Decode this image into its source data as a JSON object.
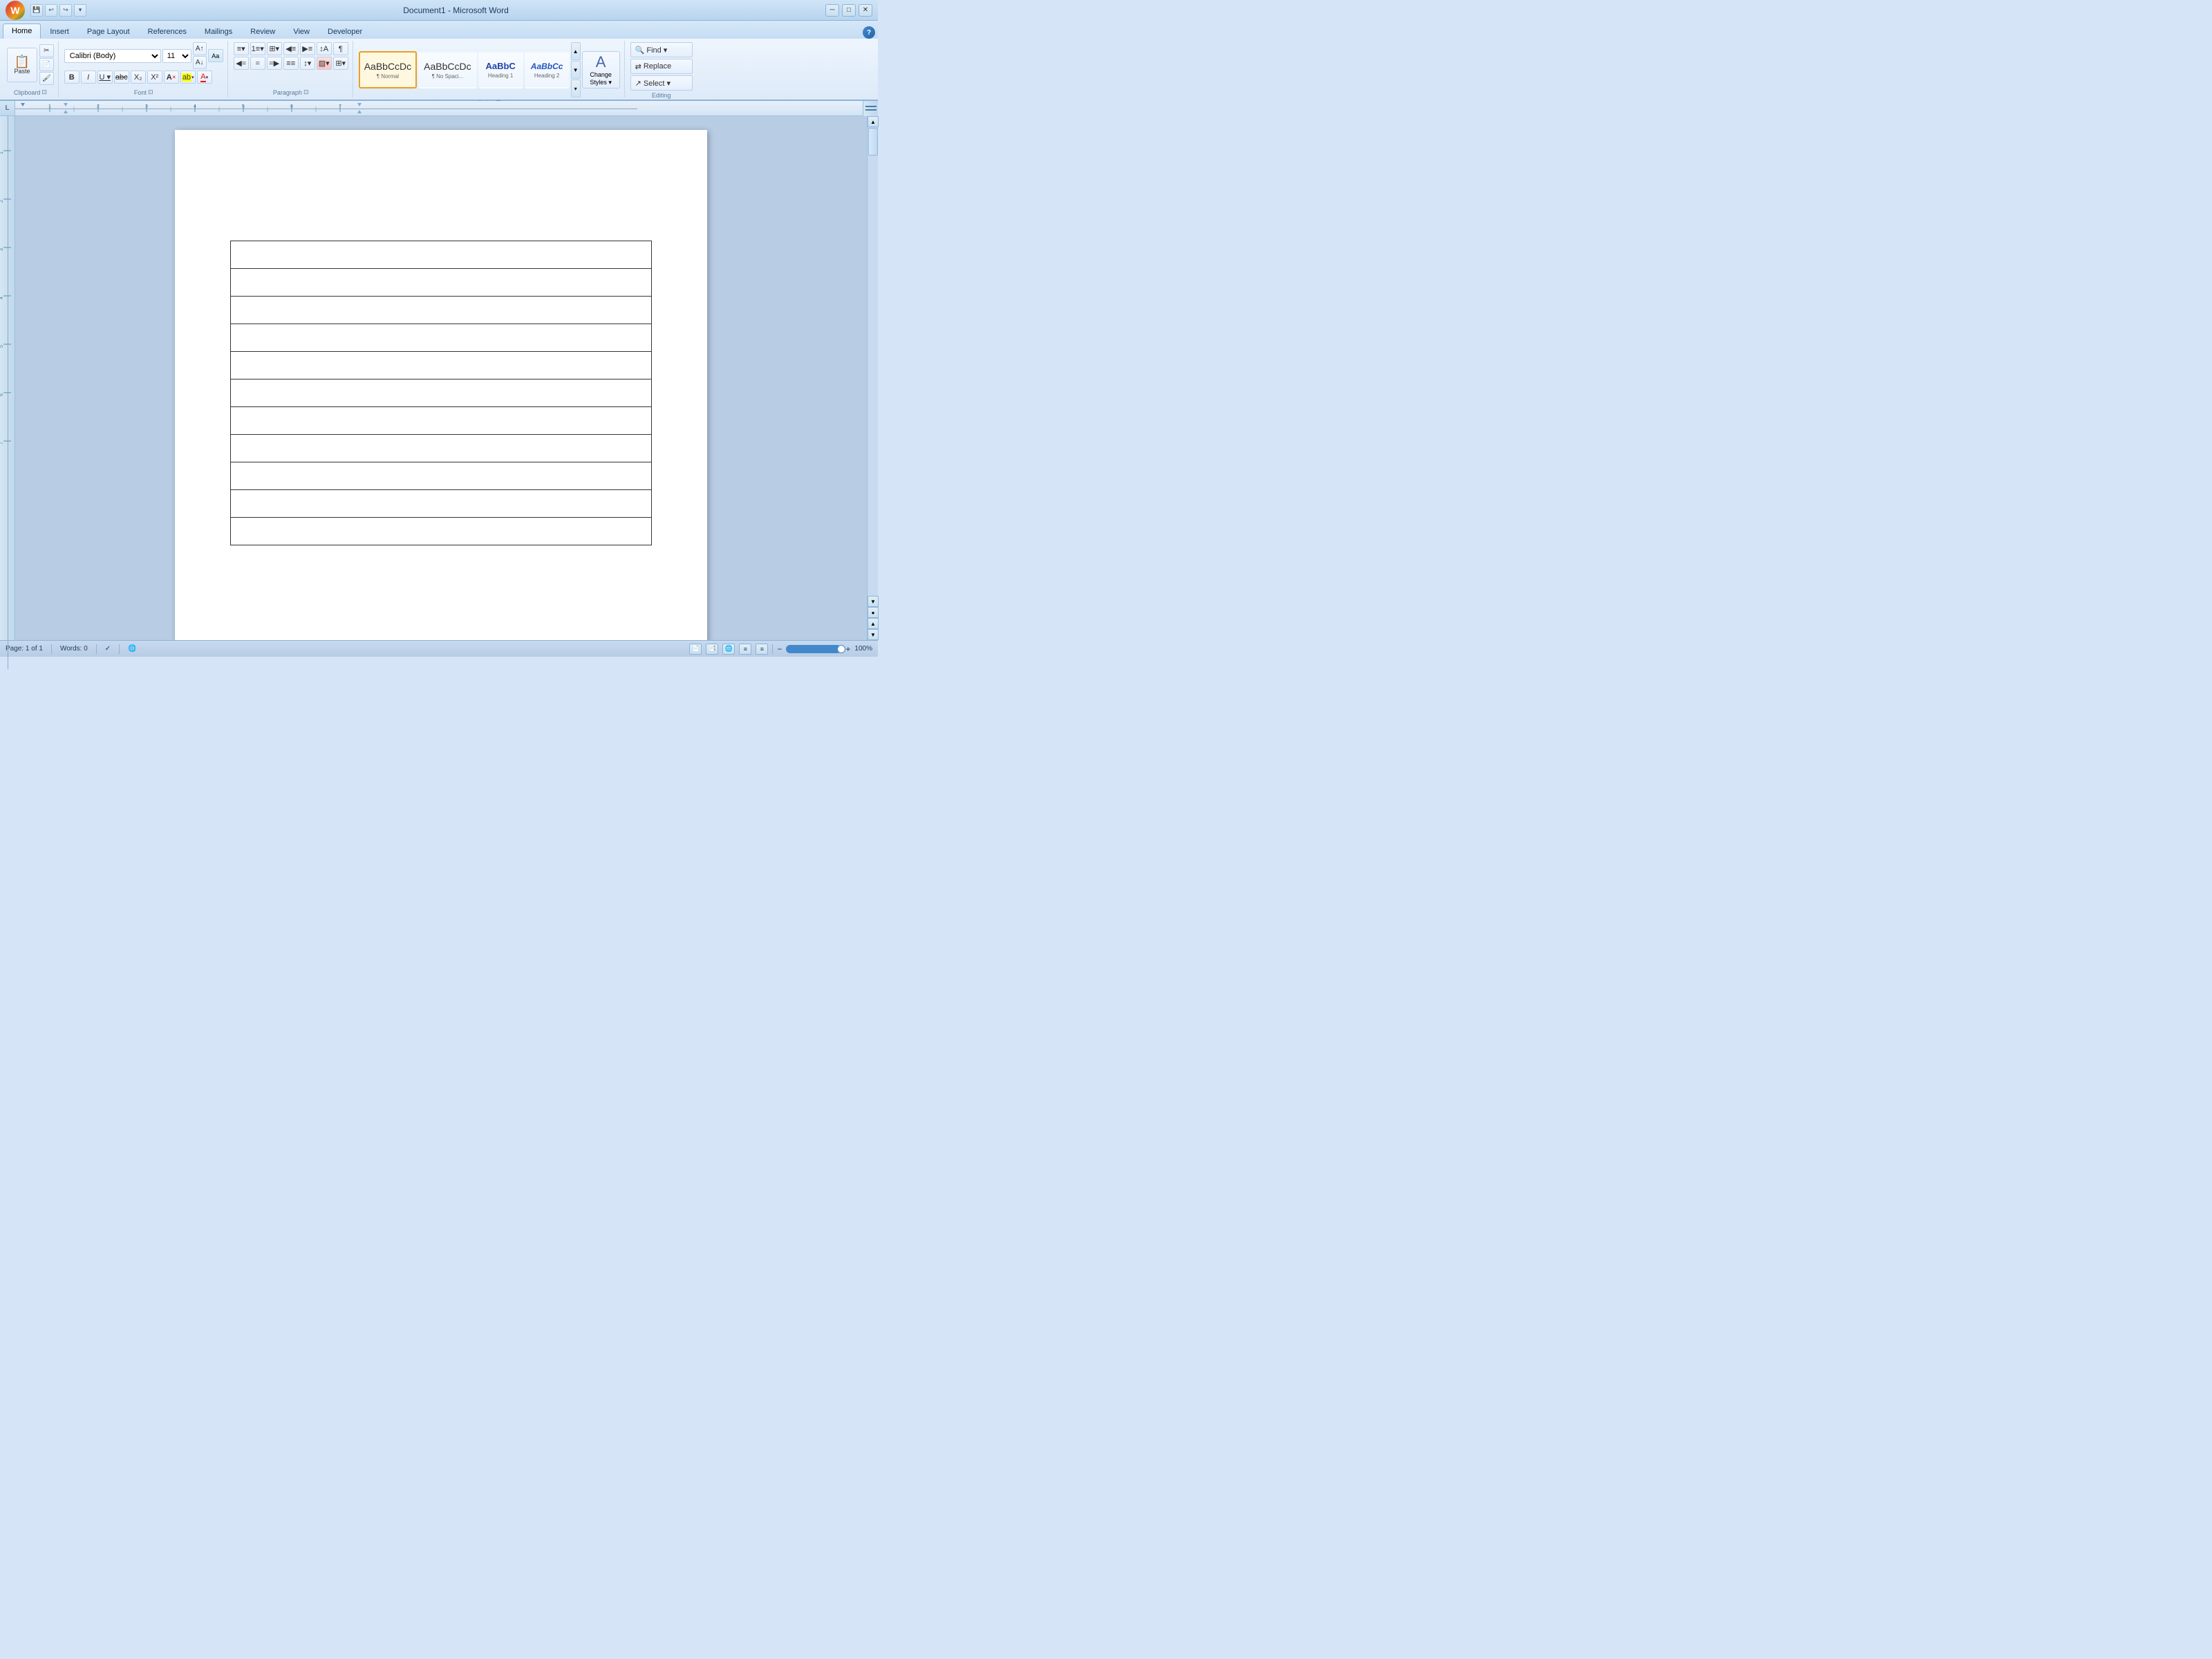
{
  "titleBar": {
    "title": "Document1 - Microsoft Word",
    "minimize": "─",
    "restore": "□",
    "close": "✕",
    "quickAccess": [
      "💾",
      "↩",
      "↪",
      "▾"
    ]
  },
  "tabs": [
    {
      "label": "Home",
      "active": true
    },
    {
      "label": "Insert",
      "active": false
    },
    {
      "label": "Page Layout",
      "active": false
    },
    {
      "label": "References",
      "active": false
    },
    {
      "label": "Mailings",
      "active": false
    },
    {
      "label": "Review",
      "active": false
    },
    {
      "label": "View",
      "active": false
    },
    {
      "label": "Developer",
      "active": false
    }
  ],
  "ribbon": {
    "clipboard": {
      "label": "Clipboard",
      "paste_label": "Paste",
      "buttons": [
        "✂",
        "📋",
        "🖌"
      ]
    },
    "font": {
      "label": "Font",
      "fontName": "Calibri (Body)",
      "fontSize": "11",
      "buttons_row1": [
        "A↑",
        "A↓",
        "Aa"
      ],
      "bold": "B",
      "italic": "I",
      "underline": "U",
      "strikethrough": "abc",
      "subscript": "X₂",
      "superscript": "X²",
      "clearFormat": "A",
      "highlightColor": "ab",
      "fontColor": "A"
    },
    "paragraph": {
      "label": "Paragraph",
      "buttons_row1": [
        "≡",
        "≡",
        "≡",
        "⊞",
        "↕",
        "¶"
      ],
      "buttons_row2": [
        "◀",
        "◀",
        "▶",
        "▶",
        "⊟",
        "▦",
        "▤"
      ]
    },
    "styles": {
      "label": "Styles",
      "items": [
        {
          "preview": "AaBbCcDc",
          "label": "¶ Normal",
          "sublabel": "",
          "active": true
        },
        {
          "preview": "AaBbCcDc",
          "label": "¶ No Spaci...",
          "sublabel": "",
          "active": false
        },
        {
          "preview": "AaBbC",
          "label": "Heading 1",
          "sublabel": "",
          "active": false
        },
        {
          "preview": "AaBbCc",
          "label": "Heading 2",
          "sublabel": "",
          "active": false
        }
      ],
      "changeStyles": "Change\nStyles"
    },
    "editing": {
      "label": "Editing",
      "find": "🔍 Find",
      "replace": "Replace",
      "select": "▾ Select"
    }
  },
  "ruler": {
    "corner": "L",
    "unit": "inches"
  },
  "document": {
    "tableRows": 11,
    "tableCols": 1
  },
  "statusBar": {
    "page": "Page: 1 of 1",
    "words": "Words: 0",
    "proofing": "✓",
    "views": [
      "📄",
      "📑",
      "▦",
      "≡",
      "⊞"
    ],
    "zoom": "100%",
    "zoomMinus": "−",
    "zoomPlus": "+"
  }
}
